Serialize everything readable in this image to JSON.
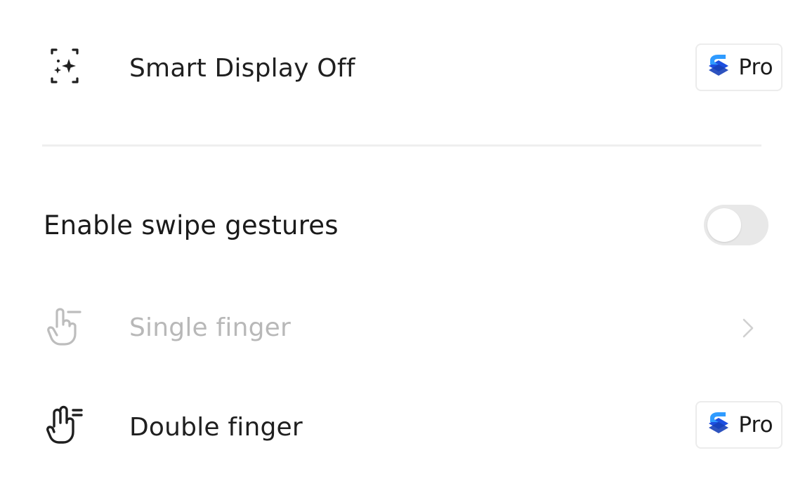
{
  "rows": {
    "smart_display": {
      "label": "Smart Display Off",
      "icon": "smart-display-sparkle-icon",
      "badge": {
        "text": "Pro",
        "icon": "pro-logo-icon"
      }
    },
    "swipe_section": {
      "label": "Enable swipe gestures",
      "toggle_on": false
    },
    "single_finger": {
      "label": "Single finger",
      "icon": "single-finger-icon",
      "disabled": true,
      "trailing": "chevron-right-icon"
    },
    "double_finger": {
      "label": "Double finger",
      "icon": "double-finger-icon",
      "badge": {
        "text": "Pro",
        "icon": "pro-logo-icon"
      }
    }
  },
  "colors": {
    "pro_logo_top": "#2f9bff",
    "pro_logo_bottom": "#1d4fe0",
    "disabled_text": "#b8b8b8",
    "primary_text": "#1f1f1f",
    "toggle_off_track": "#e8e8e8"
  }
}
